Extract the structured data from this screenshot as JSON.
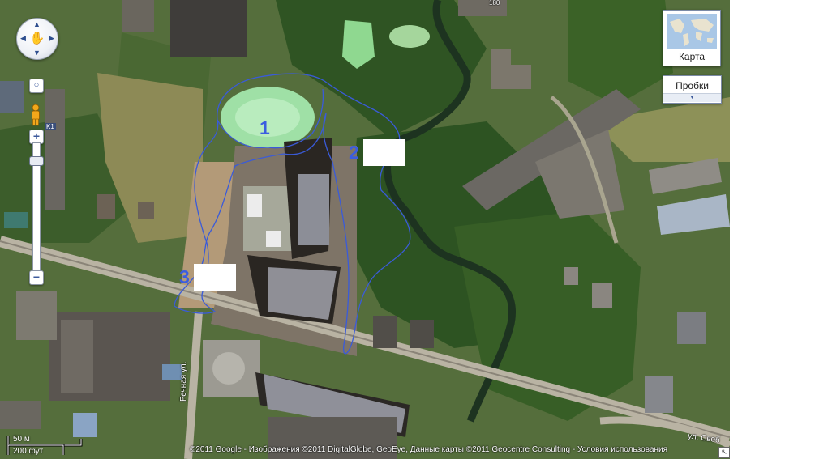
{
  "controls": {
    "pan_icon": "hand-pan-icon",
    "pegman_icon": "pegman-icon",
    "zoom_in_label": "+",
    "zoom_out_label": "−",
    "reset_label": "○",
    "layer_badge": "K1"
  },
  "map_type": {
    "label": "Карта",
    "icon": "world-map-icon"
  },
  "traffic": {
    "label": "Пробки",
    "icon": "chevron-down-icon"
  },
  "markers": [
    {
      "id": "1",
      "text": "1"
    },
    {
      "id": "2",
      "text": "2"
    },
    {
      "id": "3",
      "text": "3"
    }
  ],
  "streets": {
    "rechnaya": "Речная ул.",
    "svob": "ул. Своб"
  },
  "house_number": "180",
  "scale": {
    "metric": "50 м",
    "imperial": "200 фут"
  },
  "attribution": "©2011 Google - Изображения ©2011 DigitalGlobe, GeoEye, Данные карты ©2011 Geocentre Consulting - Условия использования",
  "colors": {
    "outline": "#3a5bd9",
    "marker_text": "#3b5de0",
    "pond": "#9fe0a6"
  }
}
